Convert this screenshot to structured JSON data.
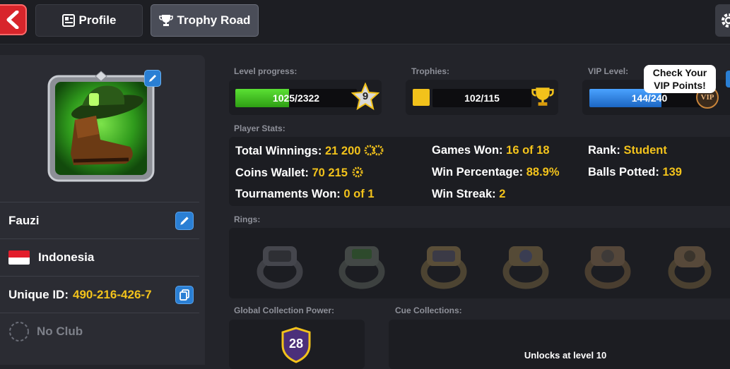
{
  "header": {
    "tabs": [
      {
        "label": "Profile",
        "icon": "profile-card-icon"
      },
      {
        "label": "Trophy Road",
        "icon": "trophy-icon"
      }
    ]
  },
  "profile": {
    "name": "Fauzi",
    "country": "Indonesia",
    "unique_id_label": "Unique ID:",
    "unique_id": "490-216-426-7",
    "club": "No Club"
  },
  "progress": {
    "level_label": "Level progress:",
    "level_text": "1025/2322",
    "level_fraction": 0.441,
    "level_number": "9",
    "trophies_label": "Trophies:",
    "trophies_text": "102/115",
    "vip_label": "VIP Level:",
    "vip_text": "144/240",
    "vip_fraction": 0.6,
    "vip_badge": "VIP",
    "vip_tooltip": "Check Your VIP Points!"
  },
  "stats": {
    "section_label": "Player Stats:",
    "items": [
      {
        "label": "Total Winnings:",
        "value": "21 200"
      },
      {
        "label": "Coins Wallet:",
        "value": "70 215"
      },
      {
        "label": "Tournaments Won:",
        "value": "0 of 1"
      },
      {
        "label": "Games Won:",
        "value": "16 of 18"
      },
      {
        "label": "Win Percentage:",
        "value": "88.9%"
      },
      {
        "label": "Win Streak:",
        "value": "2"
      },
      {
        "label": "Rank:",
        "value": "Student"
      },
      {
        "label": "Balls Potted:",
        "value": "139"
      }
    ]
  },
  "rings": {
    "section_label": "Rings:"
  },
  "collection": {
    "global_label": "Global Collection Power:",
    "global_value": "28",
    "cue_label": "Cue Collections:",
    "cue_unlock_text": "Unlocks at level 10"
  },
  "colors": {
    "accent_gold": "#f2c21b",
    "level_bar": "#3ec21a",
    "vip_bar": "#2f86e0",
    "back_red": "#d8252b",
    "button_blue": "#2a7fd4"
  }
}
